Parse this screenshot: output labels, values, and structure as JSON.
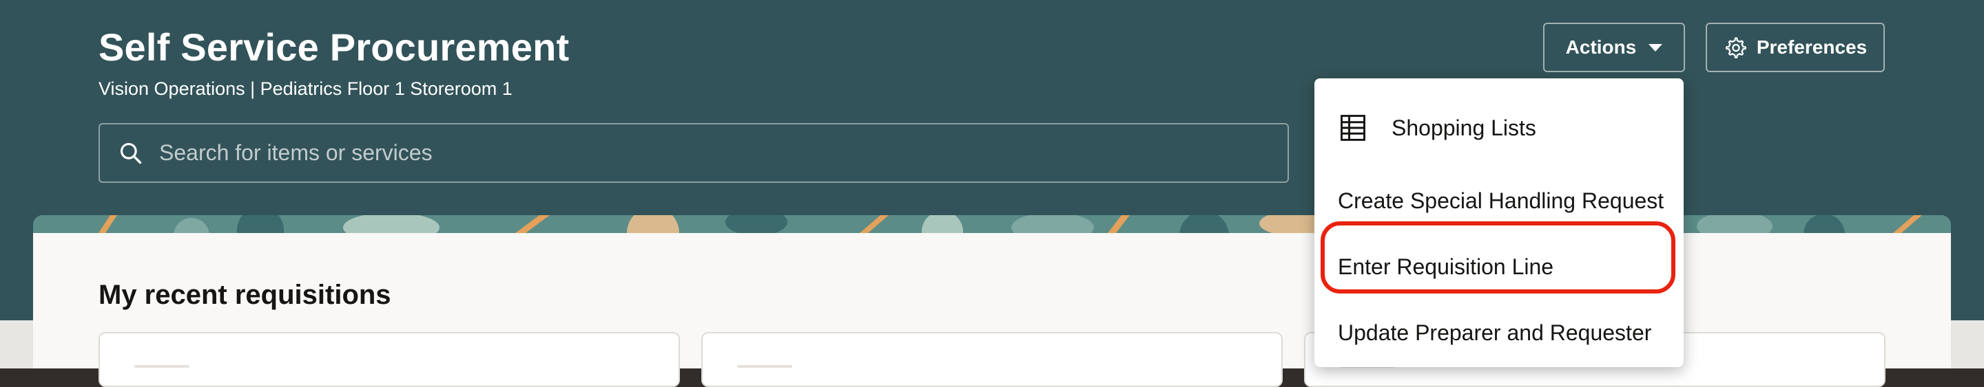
{
  "header": {
    "title": "Self Service Procurement",
    "subtitle": "Vision Operations | Pediatrics Floor 1 Storeroom 1",
    "actions_label": "Actions",
    "preferences_label": "Preferences"
  },
  "search": {
    "placeholder": "Search for items or services"
  },
  "main": {
    "section_title": "My recent requisitions"
  },
  "actions_menu": {
    "items": [
      {
        "label": "Shopping Lists",
        "icon": "table-icon"
      },
      {
        "label": "Create Special Handling Request"
      },
      {
        "label": "Enter Requisition Line",
        "highlighted": true
      },
      {
        "label": "Update Preparer and Requester"
      }
    ]
  },
  "colors": {
    "header_background": "#325359",
    "highlight_ring": "#e8230f",
    "menu_background": "#ffffff"
  }
}
